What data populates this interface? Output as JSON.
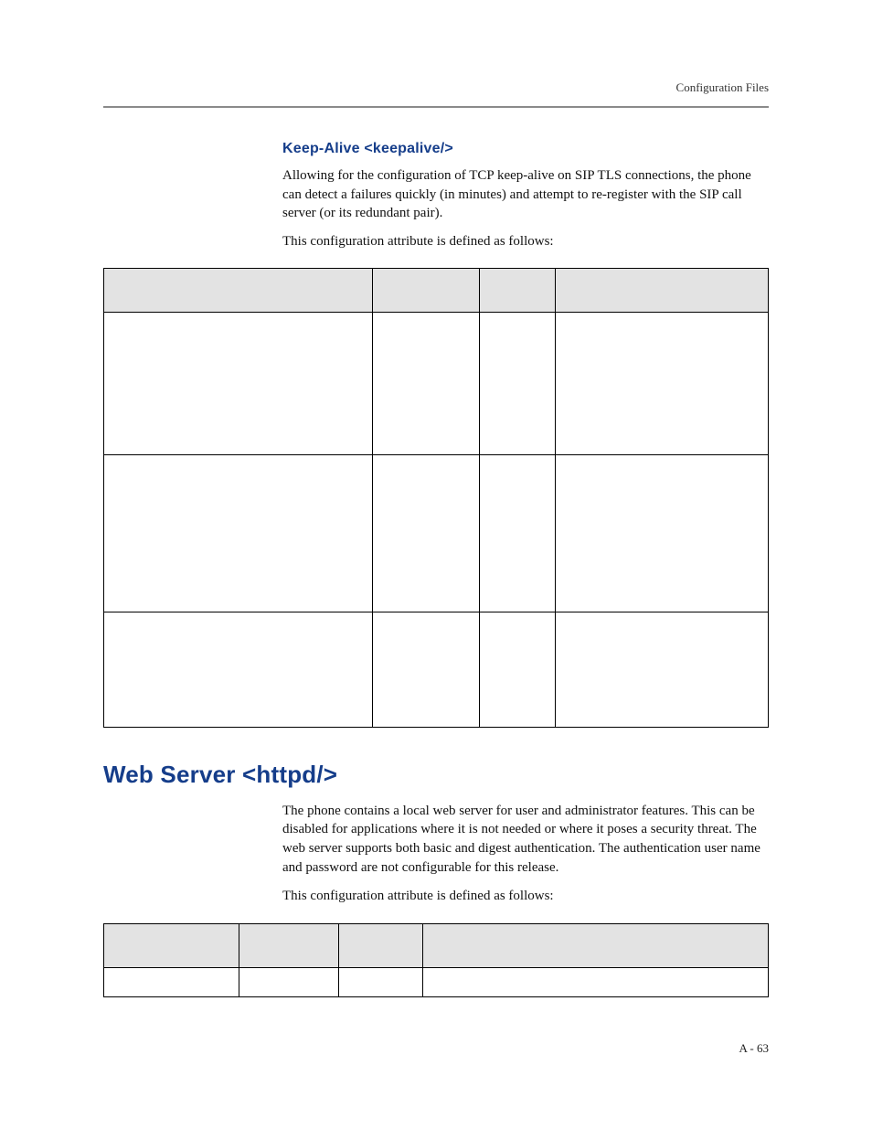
{
  "running_head": "Configuration Files",
  "section1": {
    "heading": "Keep-Alive <keepalive/>",
    "para1": "Allowing for the configuration of TCP keep-alive on SIP TLS connections, the phone can detect a failures quickly (in minutes) and attempt to re-register with the SIP call server (or its redundant pair).",
    "para2": "This configuration attribute is defined as follows:"
  },
  "section2": {
    "heading": "Web Server <httpd/>",
    "para1": "The phone contains a local web server for user and administrator features. This can be disabled for applications where it is not needed or where it poses a security threat. The web server supports both basic and digest authentication. The authentication user name and password are not configurable for this release.",
    "para2": "This configuration attribute is defined as follows:"
  },
  "page_number": "A - 63"
}
